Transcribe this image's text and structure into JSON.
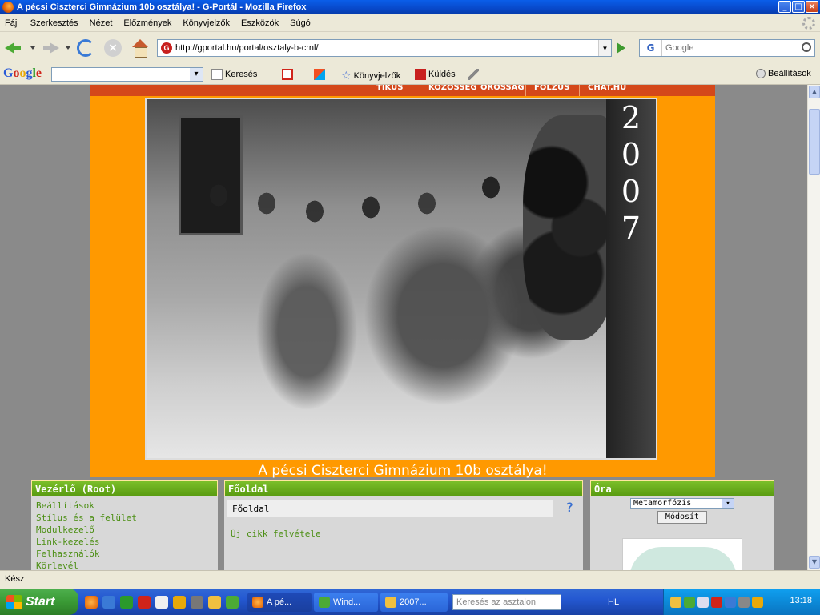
{
  "window": {
    "title": "A pécsi Ciszterci Gimnázium 10b osztálya! - G-Portál - Mozilla Firefox",
    "btn_min": "_",
    "btn_max": "□",
    "btn_close": "×"
  },
  "menu": [
    "Fájl",
    "Szerkesztés",
    "Nézet",
    "Előzmények",
    "Könyvjelzők",
    "Eszközök",
    "Súgó"
  ],
  "nav": {
    "url": "http://gportal.hu/portal/osztaly-b-crnl/",
    "site_icon_glyph": "G",
    "search_engine_glyph": "G",
    "search_placeholder": "Google"
  },
  "google_toolbar": {
    "logo": [
      "G",
      "o",
      "o",
      "g",
      "l",
      "e"
    ],
    "search_label": "Keresés",
    "bookmarks_label": "Könyvjelzők",
    "send_label": "Küldés",
    "settings_label": "Beállítások"
  },
  "page": {
    "top_nav": [
      "TIKUS",
      "KOZOSSEG",
      "OROSSAG",
      "FOLZUS",
      "CHAT.HU"
    ],
    "year_digits": [
      "2",
      "0",
      "0",
      "7"
    ],
    "banner_caption": "A pécsi Ciszterci Gimnázium 10b osztálya!",
    "vezerlo": {
      "title": "Vezérlő (Root)",
      "links": [
        "Beállítások",
        "Stílus és a felület",
        "Modulkezelő",
        "Link-kezelés",
        "Felhasználók",
        "Körlevél"
      ]
    },
    "fooldal": {
      "title": "Főoldal",
      "bar_label": "Főoldal",
      "help": "?",
      "new_article": "Új cikk felvétele"
    },
    "ora": {
      "title": "Óra",
      "select_value": "Metamorfózis",
      "modify_button": "Módosít"
    }
  },
  "status": {
    "text": "Kész"
  },
  "taskbar": {
    "start_label": "Start",
    "tasks": [
      "A pé...",
      "Wind...",
      "2007..."
    ],
    "desktop_search_placeholder": "Keresés az asztalon",
    "language": "HL",
    "clock": "13:18"
  },
  "colors": {
    "banner_orange": "#ff9900",
    "panel_header_green": "#6aab1e",
    "link_green": "#4c8f14",
    "xp_blue": "#2458d1"
  }
}
